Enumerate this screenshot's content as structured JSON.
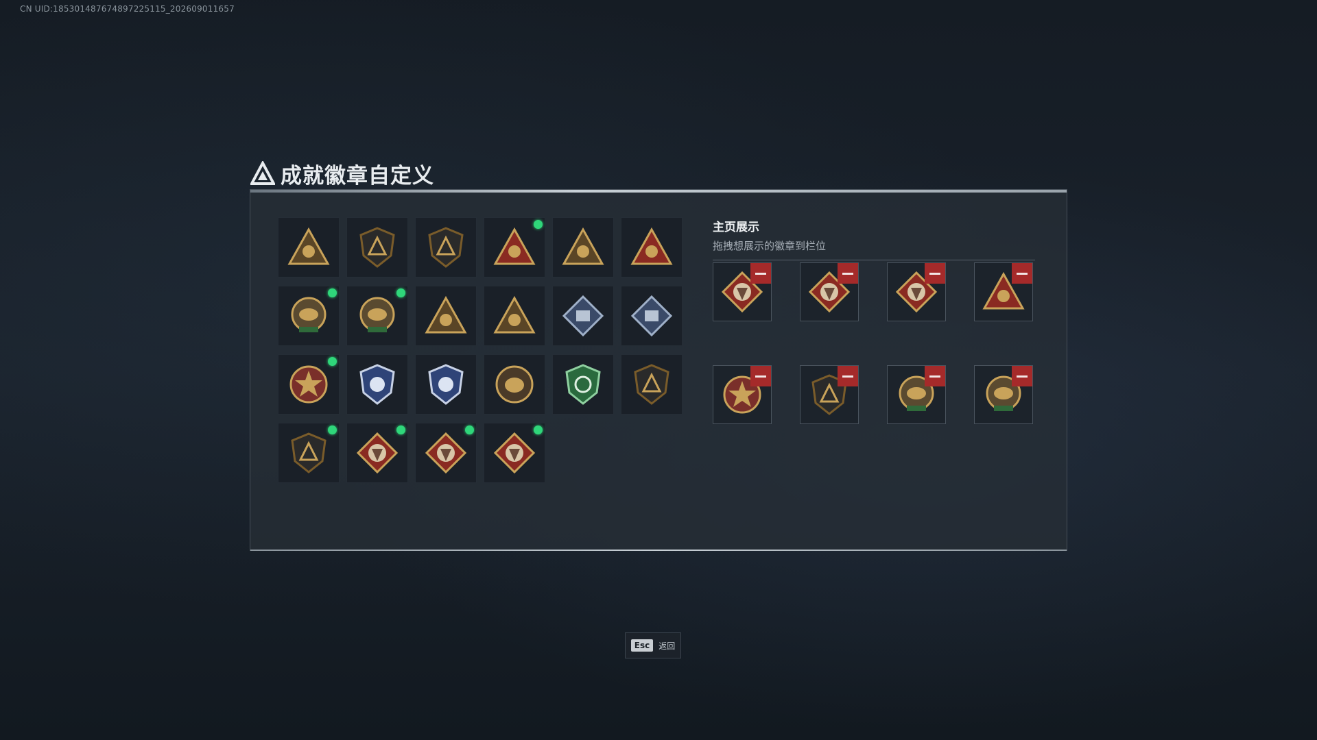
{
  "header": {
    "uid": "CN UID:185301487674897225115_202609011657",
    "title": "成就徽章自定义"
  },
  "right_panel": {
    "title": "主页展示",
    "subtitle": "拖拽想展示的徽章到栏位"
  },
  "footer": {
    "esc_key": "Esc",
    "back_label": "返回"
  },
  "colors": {
    "accent_new": "#2fd67a",
    "remove": "#a52a2a"
  },
  "badges": [
    {
      "icon": "triangle-shield-badge-icon",
      "new": false
    },
    {
      "icon": "helicopter-shield-badge-icon",
      "new": false
    },
    {
      "icon": "jet-shield-badge-icon",
      "new": false
    },
    {
      "icon": "hand-sign-triangle-badge-icon",
      "new": true
    },
    {
      "icon": "bread-triangle-badge-icon",
      "new": false
    },
    {
      "icon": "number-one-triangle-badge-icon",
      "new": false
    },
    {
      "icon": "crocodile-emblem-badge-icon",
      "new": true
    },
    {
      "icon": "delta-force-2025-badge-icon",
      "new": true
    },
    {
      "icon": "soldier-triangle-badge-icon",
      "new": false
    },
    {
      "icon": "squad-triangle-badge-icon",
      "new": false
    },
    {
      "icon": "cube-diamond-badge-icon",
      "new": false
    },
    {
      "icon": "tank-diamond-badge-icon",
      "new": false
    },
    {
      "icon": "star-medal-badge-icon",
      "new": true
    },
    {
      "icon": "blue-police-shield-badge-icon",
      "new": false
    },
    {
      "icon": "blue-gem-shield-badge-icon",
      "new": false
    },
    {
      "icon": "mask-round-badge-icon",
      "new": false
    },
    {
      "icon": "green-crosshair-shield-badge-icon",
      "new": false
    },
    {
      "icon": "no-rifle-shield-badge-icon",
      "new": false
    },
    {
      "icon": "crossed-rifles-shield-badge-icon",
      "new": true
    },
    {
      "icon": "wolf-diamond-badge-icon",
      "new": true
    },
    {
      "icon": "dragon-diamond-badge-icon",
      "new": true
    },
    {
      "icon": "runner-diamond-badge-icon",
      "new": true
    }
  ],
  "showcase": [
    {
      "icon": "dragon-diamond-badge-icon"
    },
    {
      "icon": "wolf-diamond-badge-icon"
    },
    {
      "icon": "runner-diamond-badge-icon"
    },
    {
      "icon": "hand-sign-triangle-badge-icon"
    },
    {
      "icon": "star-medal-badge-icon"
    },
    {
      "icon": "crossed-rifles-shield-badge-icon"
    },
    {
      "icon": "crocodile-emblem-badge-icon"
    },
    {
      "icon": "delta-force-2025-badge-icon"
    }
  ]
}
